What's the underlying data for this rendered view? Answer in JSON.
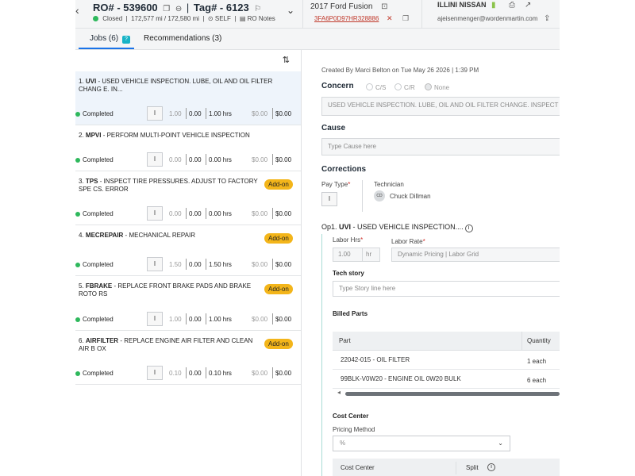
{
  "header": {
    "back_icon": "chevron-left-icon",
    "ro_number": "RO# - 539600",
    "tag": "Tag# - 6123",
    "status": "Closed",
    "mileage": "172,577 mi / 172,580 mi",
    "customer_type": "SELF",
    "ro_notes": "RO Notes",
    "vehicle": "2017 Ford Fusion",
    "vin": "3FA6P0D97HR328886",
    "dealer": "ILLINI NISSAN",
    "email": "ajeisenmenger@wordenmartin.com"
  },
  "tabs": [
    {
      "label": "Jobs (6)",
      "active": true
    },
    {
      "label": "Recommendations (3)",
      "active": false
    }
  ],
  "jobs": [
    {
      "number": "1.",
      "code": "UVI",
      "desc": " - USED VEHICLE INSPECTION. LUBE, OIL AND OIL FILTER CHANG E. IN...",
      "addon": "",
      "status": "Completed",
      "pay": "I",
      "est": "1.00",
      "hrs": "0.00",
      "billed": "1.00 hrs",
      "cost": "$0.00",
      "price": "$0.00"
    },
    {
      "number": "2.",
      "code": "MPVI",
      "desc": " - PERFORM MULTI-POINT VEHICLE INSPECTION",
      "addon": "",
      "status": "Completed",
      "pay": "I",
      "est": "0.00",
      "hrs": "0.00",
      "billed": "0.00 hrs",
      "cost": "$0.00",
      "price": "$0.00"
    },
    {
      "number": "3.",
      "code": "TPS",
      "desc": " - INSPECT TIRE PRESSURES. ADJUST TO FACTORY SPE CS. ERROR",
      "addon": "Add-on",
      "status": "Completed",
      "pay": "I",
      "est": "0.00",
      "hrs": "0.00",
      "billed": "0.00 hrs",
      "cost": "$0.00",
      "price": "$0.00"
    },
    {
      "number": "4.",
      "code": "MECREPAIR",
      "desc": " - MECHANICAL REPAIR",
      "addon": "Add-on",
      "status": "Completed",
      "pay": "I",
      "est": "1.50",
      "hrs": "0.00",
      "billed": "1.50 hrs",
      "cost": "$0.00",
      "price": "$0.00"
    },
    {
      "number": "5.",
      "code": "FBRAKE",
      "desc": " - REPLACE FRONT BRAKE PADS AND BRAKE ROTO RS",
      "addon": "Add-on",
      "status": "Completed",
      "pay": "I",
      "est": "1.00",
      "hrs": "0.00",
      "billed": "1.00 hrs",
      "cost": "$0.00",
      "price": "$0.00"
    },
    {
      "number": "6.",
      "code": "AIRFILTER",
      "desc": " - REPLACE ENGINE AIR FILTER AND CLEAN AIR B OX",
      "addon": "Add-on",
      "status": "Completed",
      "pay": "I",
      "est": "0.10",
      "hrs": "0.00",
      "billed": "0.10 hrs",
      "cost": "$0.00",
      "price": "$0.00"
    }
  ],
  "detail": {
    "created": "Created By Marci Belton on Tue May 26 2026 | 1:39 PM",
    "concern_label": "Concern",
    "concern_options": [
      "C/S",
      "C/R",
      "None"
    ],
    "concern_text": "USED VEHICLE INSPECTION. LUBE, OIL AND OIL FILTER CHANGE. INSPECT",
    "cause_label": "Cause",
    "cause_placeholder": "Type Cause here",
    "corrections_label": "Corrections",
    "pay_type_label": "Pay Type",
    "pay_type_value": "I",
    "technician_label": "Technician",
    "technician_initials": "CD",
    "technician_name": "Chuck Dillman",
    "op_prefix": "Op1.",
    "op_code": "UVI",
    "op_desc": " - USED VEHICLE INSPECTION....",
    "labor_hrs_label": "Labor Hrs",
    "labor_hrs_value": "1.00",
    "labor_hrs_unit": "hr",
    "labor_rate_label": "Labor Rate",
    "labor_rate_value": "Dynamic Pricing | Labor Grid",
    "tech_story_label": "Tech story",
    "tech_story_placeholder": "Type Story line here",
    "billed_parts_label": "Billed Parts",
    "parts_headers": [
      "Part",
      "Quantity"
    ],
    "parts": [
      {
        "part": "22042-015 - OIL FILTER",
        "qty": "1 each"
      },
      {
        "part": "99BLK-V0W20 - ENGINE OIL 0W20 BULK",
        "qty": "6 each"
      }
    ],
    "cost_center_label": "Cost Center",
    "pricing_method_label": "Pricing Method",
    "pricing_method_value": "%",
    "cc_headers": [
      "Cost Center",
      "Split"
    ]
  }
}
